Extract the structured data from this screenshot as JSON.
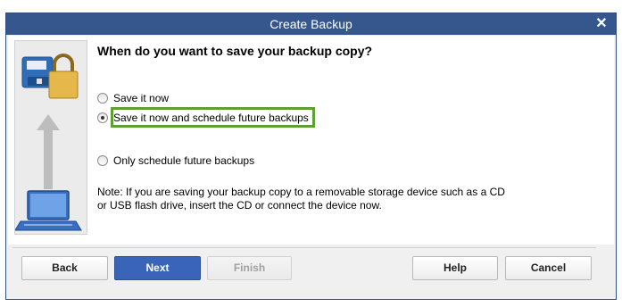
{
  "window": {
    "title": "Create Backup"
  },
  "question": "When do you want to save your backup copy?",
  "options": [
    {
      "label": "Save it now",
      "checked": false
    },
    {
      "label": "Save it now and schedule future backups",
      "checked": true
    },
    {
      "label": "Only schedule future backups",
      "checked": false
    }
  ],
  "note": {
    "line1": "Note: If you are saving your backup copy to a removable storage device such as a CD",
    "line2": "or USB flash drive, insert the CD or connect the device now."
  },
  "buttons": {
    "back": "Back",
    "next": "Next",
    "finish": "Finish",
    "help": "Help",
    "cancel": "Cancel"
  },
  "colors": {
    "titlebar": "#35578d",
    "primary_button": "#3a64b8",
    "highlight": "#5d9f30"
  }
}
